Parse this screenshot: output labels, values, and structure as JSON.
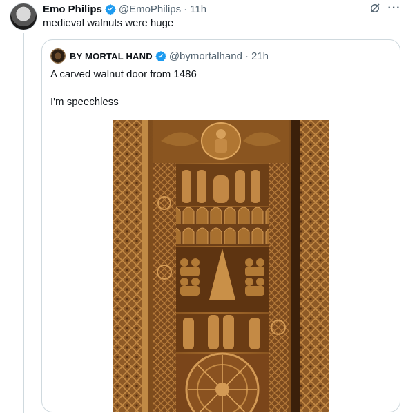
{
  "tweet": {
    "author_name": "Emo Philips",
    "author_handle": "@EmoPhilips",
    "separator": "·",
    "time": "11h",
    "text": "medieval walnuts were huge"
  },
  "quote": {
    "author_name": "BY MORTAL HAND",
    "author_handle": "@bymortalhand",
    "separator": "·",
    "time": "21h",
    "text_line1": "A carved walnut door from 1486",
    "text_line2": "I'm speechless"
  },
  "icons": {
    "verified": "verified-badge-icon",
    "grok": "grok-icon",
    "more": "more-options-icon"
  },
  "colors": {
    "verified_blue": "#1d9bf0",
    "secondary_text": "#536471",
    "border": "#cfd9de",
    "wood": "#8b5a2b"
  }
}
